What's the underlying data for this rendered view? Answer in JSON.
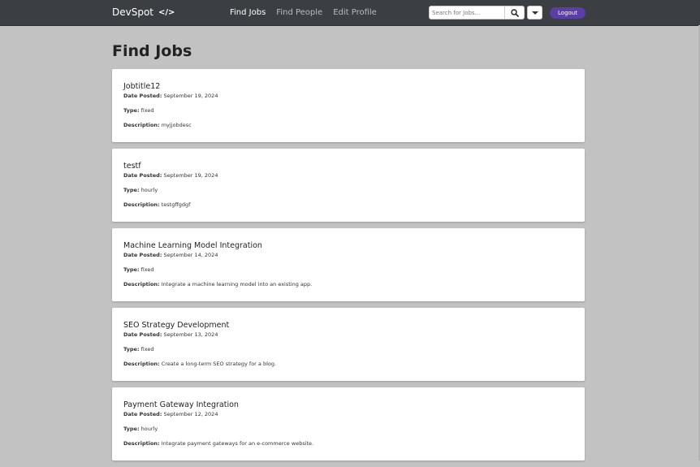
{
  "navbar": {
    "brand": "DevSpot",
    "brand_icon": "code-icon",
    "links": [
      {
        "label": "Find Jobs",
        "active": true
      },
      {
        "label": "Find People",
        "active": false
      },
      {
        "label": "Edit Profile",
        "active": false
      }
    ],
    "search": {
      "placeholder": "Search for Jobs...",
      "value": ""
    },
    "logout_label": "Logout",
    "colors": {
      "bar": "#3b3f44",
      "logout": "#5b3fa3"
    }
  },
  "page": {
    "title": "Find Jobs",
    "background": "#c2c2c2"
  },
  "labels": {
    "date_posted": "Date Posted:",
    "type": "Type:",
    "description": "Description:"
  },
  "jobs": [
    {
      "title": "Jobtitle12",
      "date": "September 19, 2024",
      "type": "fixed",
      "description": "myjjobdesc"
    },
    {
      "title": "testf",
      "date": "September 19, 2024",
      "type": "hourly",
      "description": "testgffgdgf"
    },
    {
      "title": "Machine Learning Model Integration",
      "date": "September 14, 2024",
      "type": "fixed",
      "description": "Integrate a machine learning model into an existing app."
    },
    {
      "title": "SEO Strategy Development",
      "date": "September 13, 2024",
      "type": "fixed",
      "description": "Create a long-term SEO strategy for a blog."
    },
    {
      "title": "Payment Gateway Integration",
      "date": "September 12, 2024",
      "type": "hourly",
      "description": "Integrate payment gateways for an e-commerce website."
    }
  ]
}
